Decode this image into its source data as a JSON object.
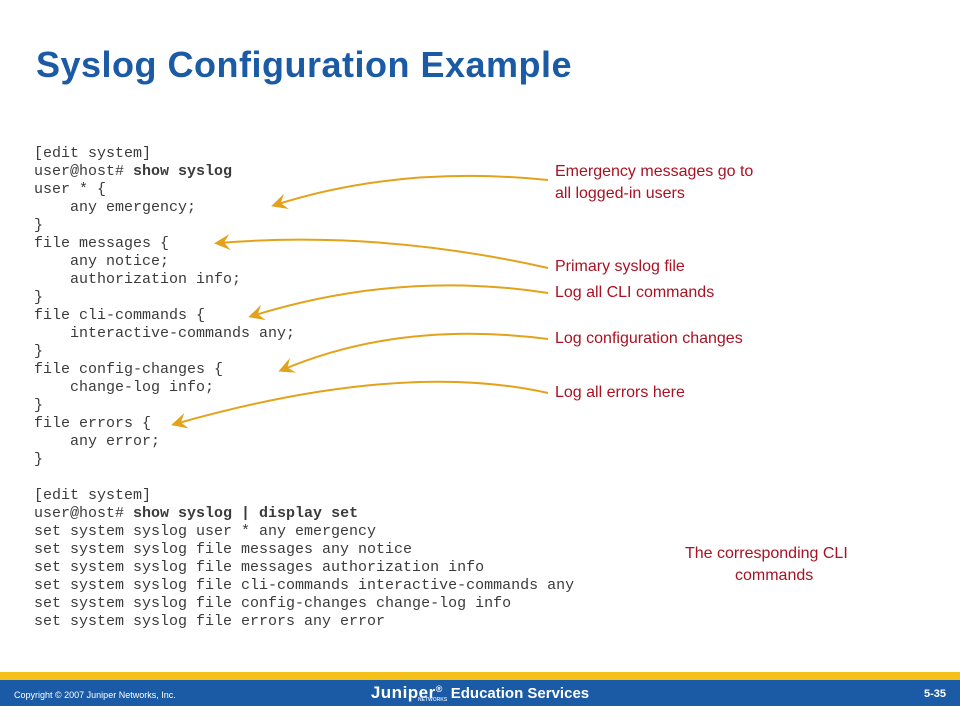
{
  "title": "Syslog Configuration Example",
  "code": [
    {
      "indent": 0,
      "segs": [
        {
          "t": "[edit system]"
        }
      ]
    },
    {
      "indent": 0,
      "segs": [
        {
          "t": "user@host# "
        },
        {
          "t": "show syslog",
          "b": true
        }
      ]
    },
    {
      "indent": 0,
      "segs": [
        {
          "t": "user * {"
        }
      ]
    },
    {
      "indent": 1,
      "segs": [
        {
          "t": "any emergency;"
        }
      ]
    },
    {
      "indent": 0,
      "segs": [
        {
          "t": "}"
        }
      ]
    },
    {
      "indent": 0,
      "segs": [
        {
          "t": "file messages {"
        }
      ]
    },
    {
      "indent": 1,
      "segs": [
        {
          "t": "any notice;"
        }
      ]
    },
    {
      "indent": 1,
      "segs": [
        {
          "t": "authorization info;"
        }
      ]
    },
    {
      "indent": 0,
      "segs": [
        {
          "t": "}"
        }
      ]
    },
    {
      "indent": 0,
      "segs": [
        {
          "t": "file cli-commands {"
        }
      ]
    },
    {
      "indent": 1,
      "segs": [
        {
          "t": "interactive-commands any;"
        }
      ]
    },
    {
      "indent": 0,
      "segs": [
        {
          "t": "}"
        }
      ]
    },
    {
      "indent": 0,
      "segs": [
        {
          "t": "file config-changes {"
        }
      ]
    },
    {
      "indent": 1,
      "segs": [
        {
          "t": "change-log info;"
        }
      ]
    },
    {
      "indent": 0,
      "segs": [
        {
          "t": "}"
        }
      ]
    },
    {
      "indent": 0,
      "segs": [
        {
          "t": "file errors {"
        }
      ]
    },
    {
      "indent": 1,
      "segs": [
        {
          "t": "any error;"
        }
      ]
    },
    {
      "indent": 0,
      "segs": [
        {
          "t": "}"
        }
      ]
    },
    {
      "indent": 0,
      "segs": [
        {
          "t": ""
        }
      ]
    },
    {
      "indent": 0,
      "segs": [
        {
          "t": "[edit system]"
        }
      ]
    },
    {
      "indent": 0,
      "segs": [
        {
          "t": "user@host# "
        },
        {
          "t": "show syslog | display set",
          "b": true
        }
      ]
    },
    {
      "indent": 0,
      "segs": [
        {
          "t": "set system syslog user * any emergency"
        }
      ]
    },
    {
      "indent": 0,
      "segs": [
        {
          "t": "set system syslog file messages any notice"
        }
      ]
    },
    {
      "indent": 0,
      "segs": [
        {
          "t": "set system syslog file messages authorization info"
        }
      ]
    },
    {
      "indent": 0,
      "segs": [
        {
          "t": "set system syslog file cli-commands interactive-commands any"
        }
      ]
    },
    {
      "indent": 0,
      "segs": [
        {
          "t": "set system syslog file config-changes change-log info"
        }
      ]
    },
    {
      "indent": 0,
      "segs": [
        {
          "t": "set system syslog file errors any error"
        }
      ]
    }
  ],
  "annotations": {
    "a1_l1": "Emergency messages go to",
    "a1_l2": "all logged-in users",
    "a2": "Primary syslog file",
    "a3": "Log all CLI commands",
    "a4": "Log configuration changes",
    "a5": "Log all errors here",
    "a6_l1": "The corresponding CLI",
    "a6_l2": "commands"
  },
  "footer": {
    "copyright": "Copyright © 2007 Juniper Networks, Inc.",
    "logo_text": "Juniper",
    "logo_sub": "NETWORKS",
    "reg": "®",
    "edu": "Education Services",
    "page": "5-35"
  }
}
